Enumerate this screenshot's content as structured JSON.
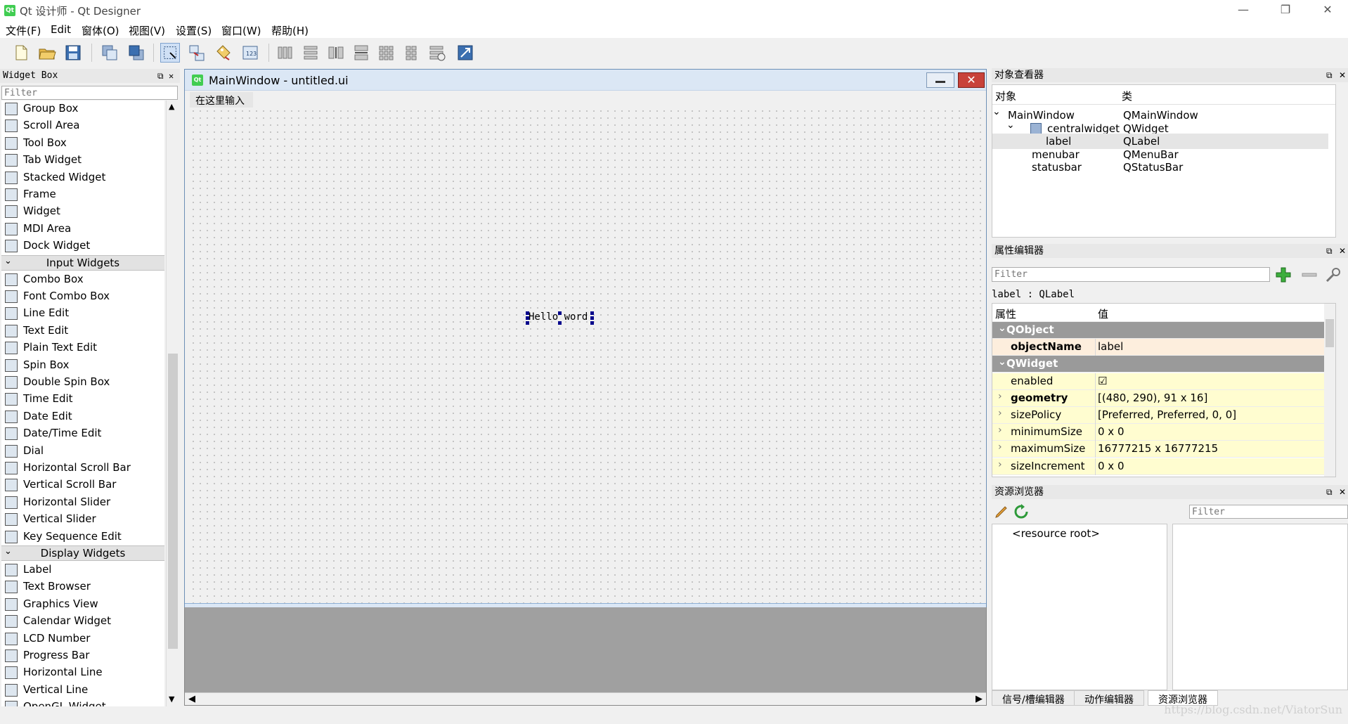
{
  "window": {
    "title": "Qt 设计师 - Qt Designer",
    "app_icon_text": "Qt",
    "min": "—",
    "max": "❐",
    "close": "✕"
  },
  "menu": [
    "文件(F)",
    "Edit",
    "窗体(O)",
    "视图(V)",
    "设置(S)",
    "窗口(W)",
    "帮助(H)"
  ],
  "widget_box": {
    "title": "Widget Box",
    "filter_placeholder": "Filter",
    "items": [
      {
        "label": "Group Box",
        "kind": "item"
      },
      {
        "label": "Scroll Area",
        "kind": "item"
      },
      {
        "label": "Tool Box",
        "kind": "item"
      },
      {
        "label": "Tab Widget",
        "kind": "item"
      },
      {
        "label": "Stacked Widget",
        "kind": "item"
      },
      {
        "label": "Frame",
        "kind": "item"
      },
      {
        "label": "Widget",
        "kind": "item"
      },
      {
        "label": "MDI Area",
        "kind": "item"
      },
      {
        "label": "Dock Widget",
        "kind": "item"
      },
      {
        "label": "Input Widgets",
        "kind": "category"
      },
      {
        "label": "Combo Box",
        "kind": "item"
      },
      {
        "label": "Font Combo Box",
        "kind": "item"
      },
      {
        "label": "Line Edit",
        "kind": "item"
      },
      {
        "label": "Text Edit",
        "kind": "item"
      },
      {
        "label": "Plain Text Edit",
        "kind": "item"
      },
      {
        "label": "Spin Box",
        "kind": "item"
      },
      {
        "label": "Double Spin Box",
        "kind": "item"
      },
      {
        "label": "Time Edit",
        "kind": "item"
      },
      {
        "label": "Date Edit",
        "kind": "item"
      },
      {
        "label": "Date/Time Edit",
        "kind": "item"
      },
      {
        "label": "Dial",
        "kind": "item"
      },
      {
        "label": "Horizontal Scroll Bar",
        "kind": "item"
      },
      {
        "label": "Vertical Scroll Bar",
        "kind": "item"
      },
      {
        "label": "Horizontal Slider",
        "kind": "item"
      },
      {
        "label": "Vertical Slider",
        "kind": "item"
      },
      {
        "label": "Key Sequence Edit",
        "kind": "item"
      },
      {
        "label": "Display Widgets",
        "kind": "category"
      },
      {
        "label": "Label",
        "kind": "item"
      },
      {
        "label": "Text Browser",
        "kind": "item"
      },
      {
        "label": "Graphics View",
        "kind": "item"
      },
      {
        "label": "Calendar Widget",
        "kind": "item"
      },
      {
        "label": "LCD Number",
        "kind": "item"
      },
      {
        "label": "Progress Bar",
        "kind": "item"
      },
      {
        "label": "Horizontal Line",
        "kind": "item"
      },
      {
        "label": "Vertical Line",
        "kind": "item"
      },
      {
        "label": "OpenGL Widget",
        "kind": "item"
      }
    ]
  },
  "form": {
    "title": "MainWindow - untitled.ui",
    "icon_text": "Qt",
    "menu_placeholder": "在这里输入",
    "label_text": "Hello word",
    "close_glyph": "✕"
  },
  "object_inspector": {
    "title": "对象查看器",
    "col_object": "对象",
    "col_class": "类",
    "rows": [
      {
        "object": "MainWindow",
        "class": "QMainWindow",
        "expander": "⌄",
        "selected": false
      },
      {
        "object": "centralwidget",
        "class": "QWidget",
        "expander": "⌄",
        "selected": false
      },
      {
        "object": "label",
        "class": "QLabel",
        "expander": "",
        "selected": true
      },
      {
        "object": "menubar",
        "class": "QMenuBar",
        "expander": "",
        "selected": false
      },
      {
        "object": "statusbar",
        "class": "QStatusBar",
        "expander": "",
        "selected": false
      }
    ]
  },
  "property_editor": {
    "title": "属性编辑器",
    "filter_placeholder": "Filter",
    "class_line": "label : QLabel",
    "col_property": "属性",
    "col_value": "值",
    "rows": [
      {
        "name": "QObject",
        "value": "",
        "kind": "group",
        "bold": false
      },
      {
        "name": "objectName",
        "value": "label",
        "kind": "prop",
        "bold": true,
        "bg": "#fdeedd"
      },
      {
        "name": "QWidget",
        "value": "",
        "kind": "group",
        "bold": false
      },
      {
        "name": "enabled",
        "value": "☑",
        "kind": "prop",
        "bold": false,
        "bg": "#fffdd0"
      },
      {
        "name": "geometry",
        "value": "[(480, 290), 91 x 16]",
        "kind": "prop",
        "bold": true,
        "bg": "#fffdd0",
        "expandable": true
      },
      {
        "name": "sizePolicy",
        "value": "[Preferred, Preferred, 0, 0]",
        "kind": "prop",
        "bold": false,
        "bg": "#fffdd0",
        "expandable": true
      },
      {
        "name": "minimumSize",
        "value": "0 x 0",
        "kind": "prop",
        "bold": false,
        "bg": "#fffdd0",
        "expandable": true
      },
      {
        "name": "maximumSize",
        "value": "16777215 x 16777215",
        "kind": "prop",
        "bold": false,
        "bg": "#fffdd0",
        "expandable": true
      },
      {
        "name": "sizeIncrement",
        "value": "0 x 0",
        "kind": "prop",
        "bold": false,
        "bg": "#fffdd0",
        "expandable": true
      }
    ]
  },
  "resource_browser": {
    "title": "资源浏览器",
    "filter_placeholder": "Filter",
    "root": "<resource root>"
  },
  "bottom_tabs": [
    "信号/槽编辑器",
    "动作编辑器",
    "资源浏览器"
  ],
  "watermark": "https://blog.csdn.net/ViatorSun",
  "colors": {
    "selection": "#00008b",
    "group_bg": "#9a9a9a",
    "qt_green": "#41cd52"
  }
}
